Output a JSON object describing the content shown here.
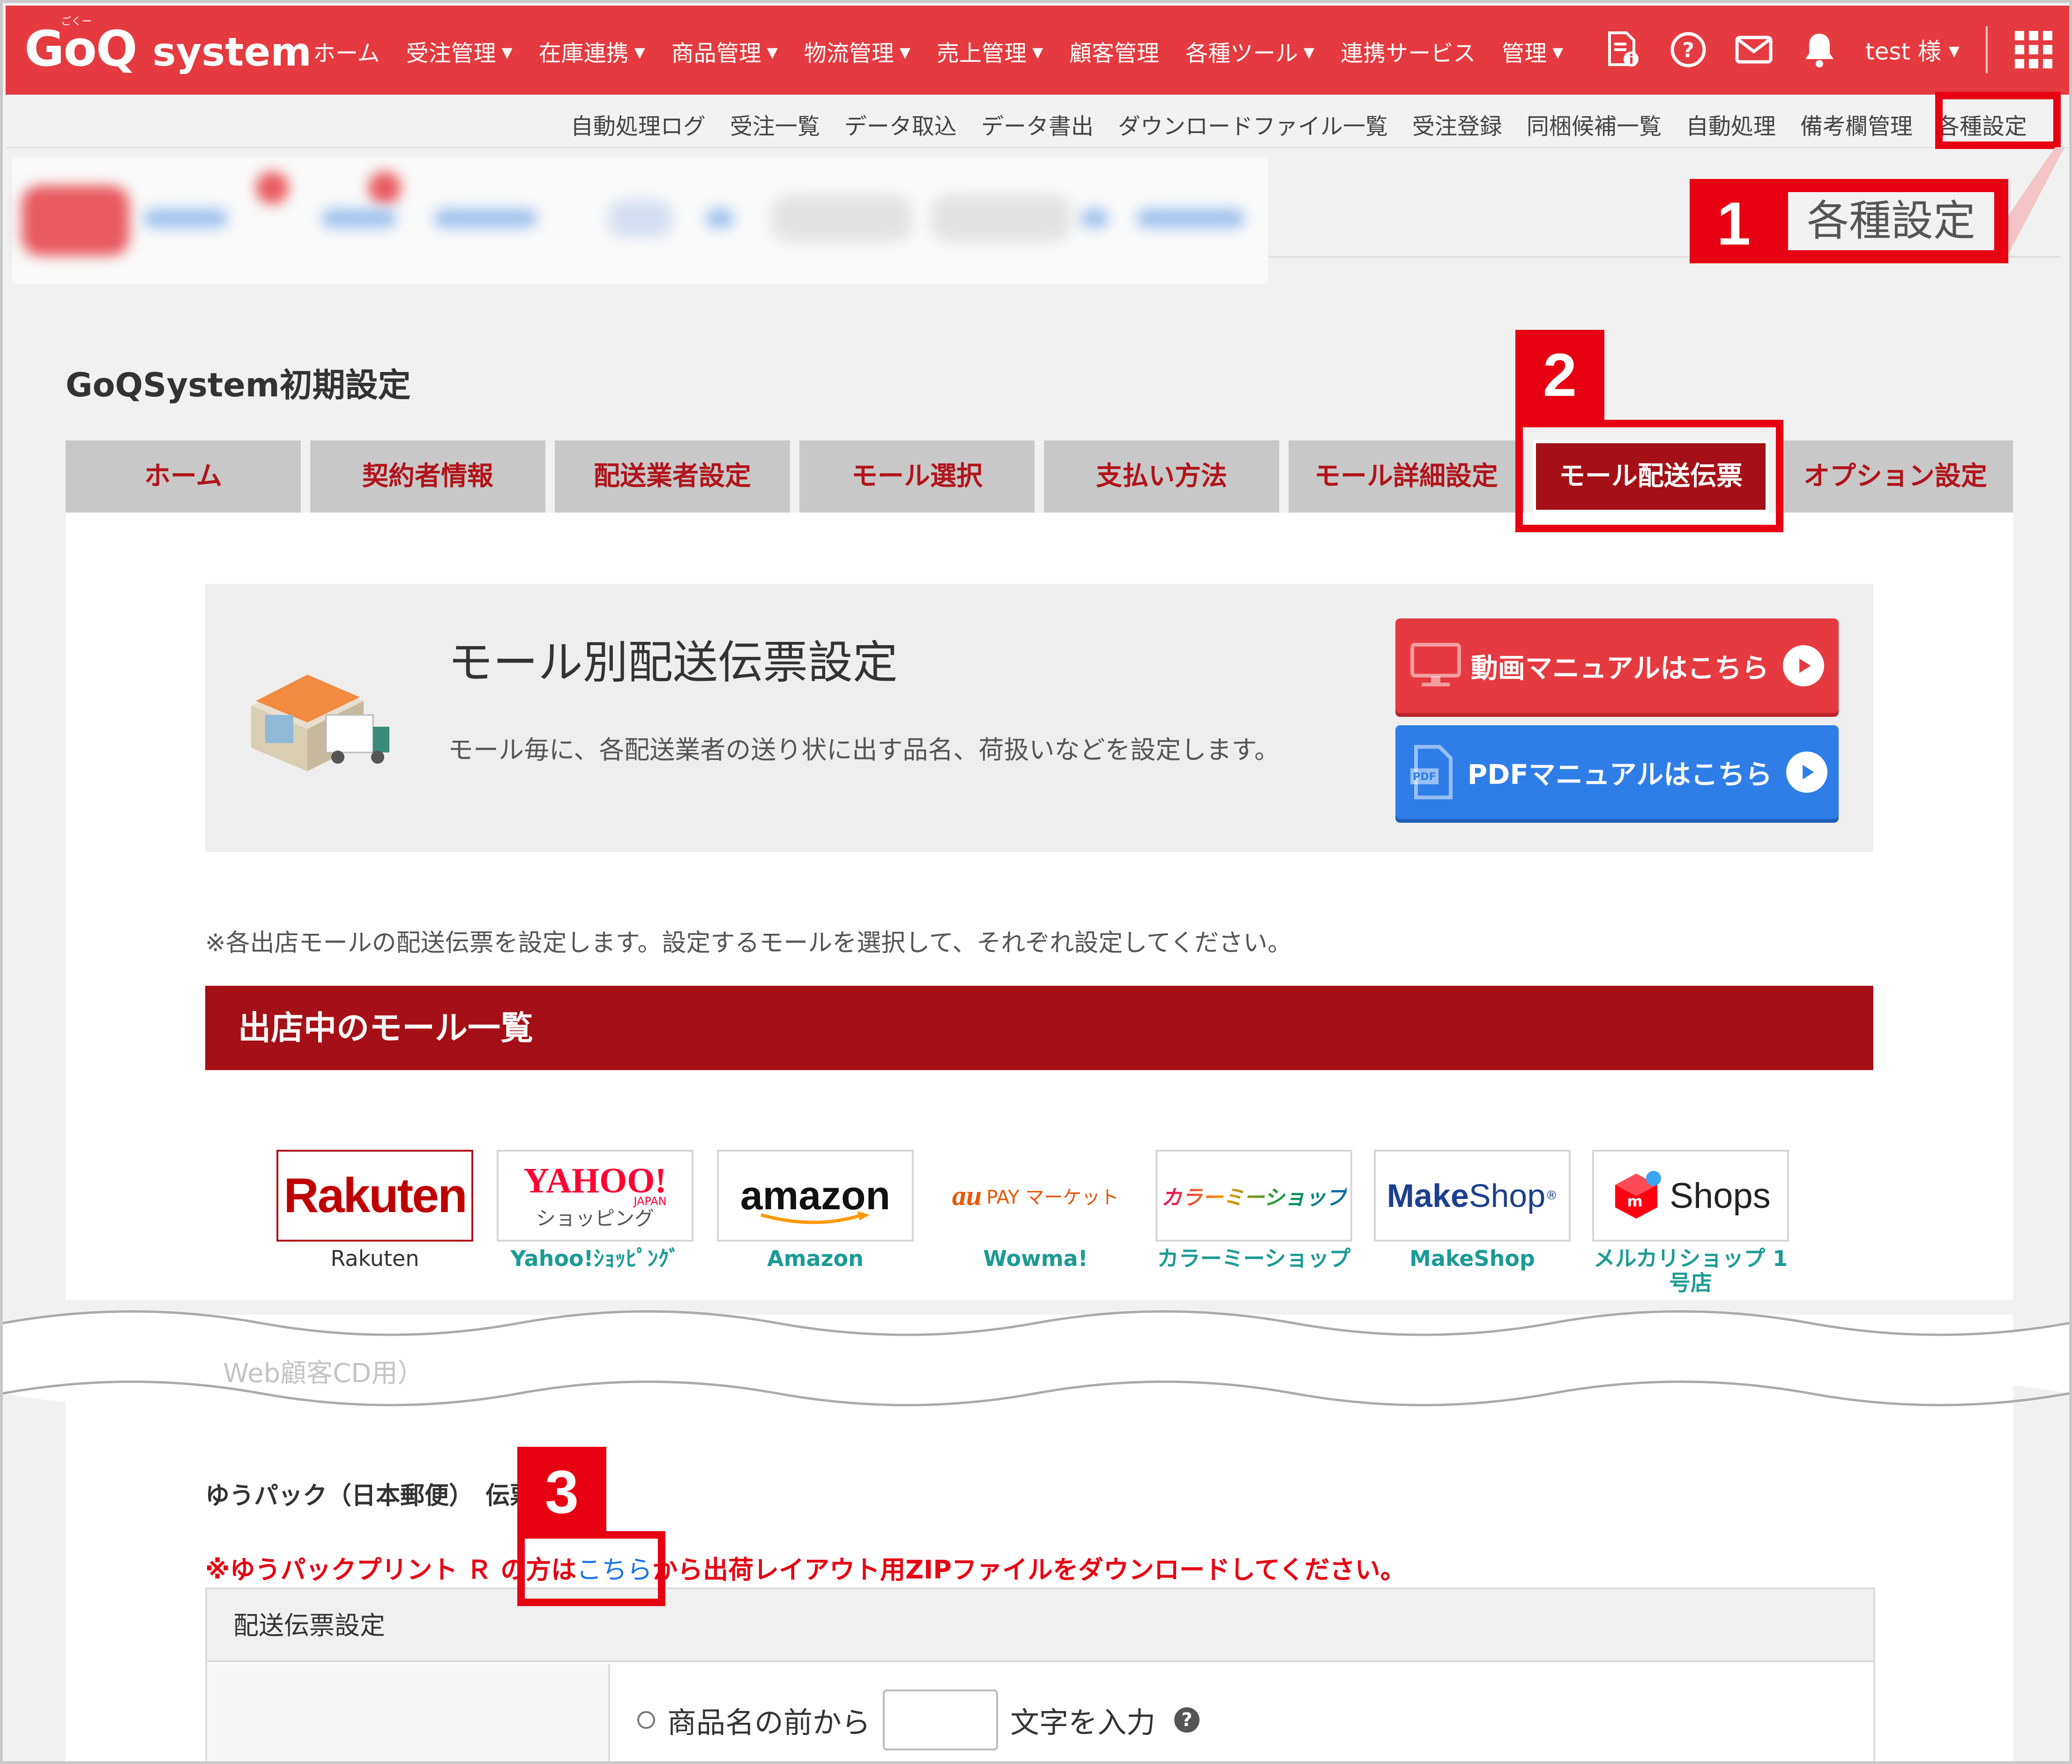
{
  "header": {
    "logo_main": "GoQ",
    "logo_sub": "system",
    "logo_ruby": "ごくー",
    "nav": [
      {
        "label": "ホーム",
        "dropdown": false
      },
      {
        "label": "受注管理",
        "dropdown": true
      },
      {
        "label": "在庫連携",
        "dropdown": true
      },
      {
        "label": "商品管理",
        "dropdown": true
      },
      {
        "label": "物流管理",
        "dropdown": true
      },
      {
        "label": "売上管理",
        "dropdown": true
      },
      {
        "label": "顧客管理",
        "dropdown": false
      },
      {
        "label": "各種ツール",
        "dropdown": true
      },
      {
        "label": "連携サービス",
        "dropdown": false
      },
      {
        "label": "管理",
        "dropdown": true
      }
    ],
    "user": "test 様",
    "caret": "▼",
    "accent": "#e53a3f"
  },
  "subnav": [
    "自動処理ログ",
    "受注一覧",
    "データ取込",
    "データ書出",
    "ダウンロードファイル一覧",
    "受注登録",
    "同梱候補一覧",
    "自動処理",
    "備考欄管理",
    "各種設定"
  ],
  "callout1": {
    "number": "1",
    "label": "各種設定"
  },
  "callout2": {
    "number": "2"
  },
  "callout3": {
    "number": "3"
  },
  "page_title": "GoQSystem初期設定",
  "tabs": [
    "ホーム",
    "契約者情報",
    "配送業者設定",
    "モール選択",
    "支払い方法",
    "モール詳細設定",
    "モール配送伝票",
    "オプション設定"
  ],
  "active_tab": "モール配送伝票",
  "info": {
    "title": "モール別配送伝票設定",
    "description": "モール毎に、各配送業者の送り状に出す品名、荷扱いなどを設定します。",
    "video_button": "動画マニュアルはこちら",
    "pdf_button": "PDFマニュアルはこちら",
    "pdf_tag": "PDF"
  },
  "note": "※各出店モールの配送伝票を設定します。設定するモールを選択して、それぞれ設定してください。",
  "mall_list_title": "出店中のモール一覧",
  "malls": [
    {
      "logo": "Rakuten",
      "caption": "Rakuten"
    },
    {
      "logo": "YAHOO! JAPAN ショッピング",
      "logo_main": "YAHOO!",
      "logo_sub1": "JAPAN",
      "logo_sub2": "ショッピング",
      "caption": "Yahoo!ｼｮｯﾋﾟﾝｸﾞ"
    },
    {
      "logo": "amazon",
      "caption": "Amazon"
    },
    {
      "logo": "au PAY マーケット",
      "logo_main": "au",
      "logo_sub1": "PAY マーケット",
      "caption": "Wowma!"
    },
    {
      "logo": "カラーミーショップ",
      "caption": "カラーミーショップ"
    },
    {
      "logo": "MakeShop",
      "logo_main": "Make",
      "logo_sub1": "Shop",
      "logo_sub2": "®",
      "caption": "MakeShop"
    },
    {
      "logo": "Shops",
      "logo_main": "Shops",
      "caption": "メルカリショップ 1号店"
    }
  ],
  "cut_text": "Web顧客CD用）",
  "yupack": {
    "heading": "ゆうパック（日本郵便）　伝票設定",
    "warning_prefix": "※ゆうパックプリント Ｒ の方は",
    "warning_link": "こちら",
    "warning_suffix": "から出荷レイアウト用ZIPファイルをダウンロードしてください。"
  },
  "table": {
    "header": "配送伝票設定",
    "radio_label_before": "商品名の前から",
    "radio_label_after": "文字を入力",
    "input_value": "",
    "help": "?"
  }
}
